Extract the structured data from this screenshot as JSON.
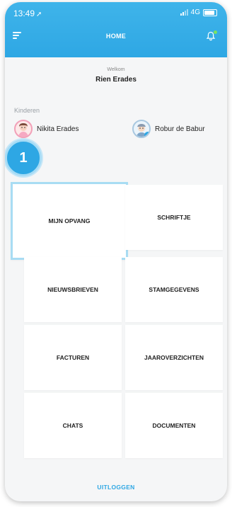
{
  "status": {
    "time": "13:49",
    "network": "4G"
  },
  "header": {
    "title": "HOME"
  },
  "welcome": {
    "greeting": "Welkom",
    "name": "Rien Erades"
  },
  "children": {
    "label": "Kinderen",
    "items": [
      {
        "name": "Nikita Erades"
      },
      {
        "name": "Robur de Babur"
      }
    ]
  },
  "step_badge": "1",
  "menu": {
    "mijn_opvang": "MIJN OPVANG",
    "schriftje": "SCHRIFTJE",
    "nieuwsbrieven": "NIEUWSBRIEVEN",
    "stamgegevens": "STAMGEGEVENS",
    "facturen": "FACTUREN",
    "jaaroverzichten": "JAAROVERZICHTEN",
    "chats": "CHATS",
    "documenten": "DOCUMENTEN"
  },
  "logout": "UITLOGGEN",
  "colors": {
    "accent": "#2ea7e4",
    "highlight": "#a8dcf3",
    "notification_dot": "#7be35e"
  }
}
